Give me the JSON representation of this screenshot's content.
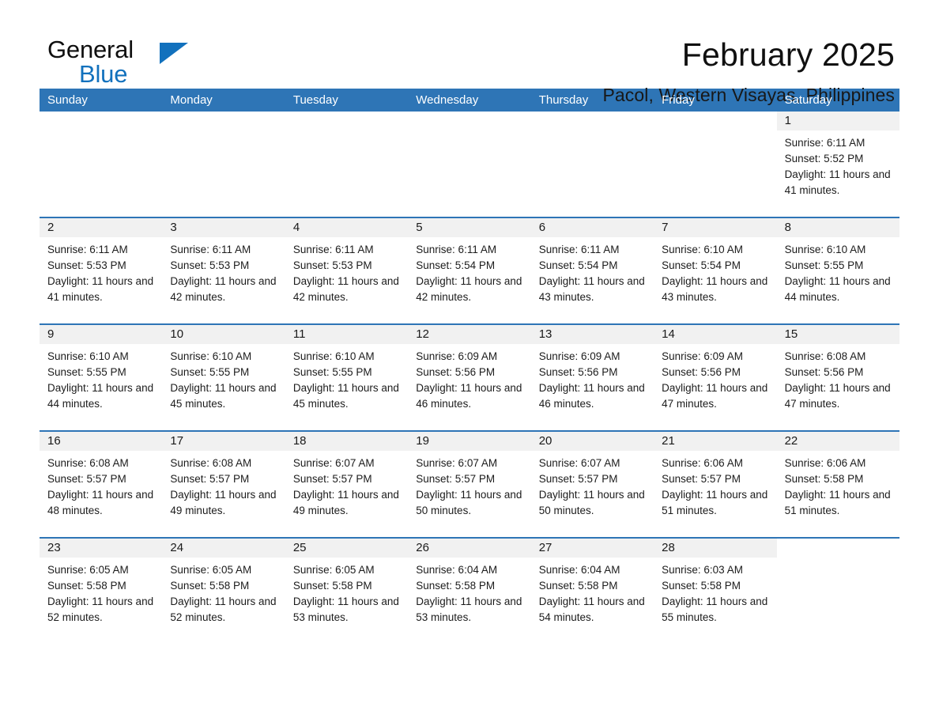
{
  "brand": {
    "name_part1": "General",
    "name_part2": "Blue",
    "triangle_color": "#1271bd"
  },
  "header": {
    "title": "February 2025",
    "subtitle": "Pacol, Western Visayas, Philippines"
  },
  "theme": {
    "header_blue": "#2e75b6",
    "date_strip_gray": "#f1f1f1",
    "text": "#1a1a1a"
  },
  "weekdays": [
    "Sunday",
    "Monday",
    "Tuesday",
    "Wednesday",
    "Thursday",
    "Friday",
    "Saturday"
  ],
  "weeks": [
    [
      {
        "date": "",
        "sunrise": "",
        "sunset": "",
        "daylight": "",
        "empty": true
      },
      {
        "date": "",
        "sunrise": "",
        "sunset": "",
        "daylight": "",
        "empty": true
      },
      {
        "date": "",
        "sunrise": "",
        "sunset": "",
        "daylight": "",
        "empty": true
      },
      {
        "date": "",
        "sunrise": "",
        "sunset": "",
        "daylight": "",
        "empty": true
      },
      {
        "date": "",
        "sunrise": "",
        "sunset": "",
        "daylight": "",
        "empty": true
      },
      {
        "date": "",
        "sunrise": "",
        "sunset": "",
        "daylight": "",
        "empty": true
      },
      {
        "date": "1",
        "sunrise": "Sunrise: 6:11 AM",
        "sunset": "Sunset: 5:52 PM",
        "daylight": "Daylight: 11 hours and 41 minutes.",
        "empty": false
      }
    ],
    [
      {
        "date": "2",
        "sunrise": "Sunrise: 6:11 AM",
        "sunset": "Sunset: 5:53 PM",
        "daylight": "Daylight: 11 hours and 41 minutes.",
        "empty": false
      },
      {
        "date": "3",
        "sunrise": "Sunrise: 6:11 AM",
        "sunset": "Sunset: 5:53 PM",
        "daylight": "Daylight: 11 hours and 42 minutes.",
        "empty": false
      },
      {
        "date": "4",
        "sunrise": "Sunrise: 6:11 AM",
        "sunset": "Sunset: 5:53 PM",
        "daylight": "Daylight: 11 hours and 42 minutes.",
        "empty": false
      },
      {
        "date": "5",
        "sunrise": "Sunrise: 6:11 AM",
        "sunset": "Sunset: 5:54 PM",
        "daylight": "Daylight: 11 hours and 42 minutes.",
        "empty": false
      },
      {
        "date": "6",
        "sunrise": "Sunrise: 6:11 AM",
        "sunset": "Sunset: 5:54 PM",
        "daylight": "Daylight: 11 hours and 43 minutes.",
        "empty": false
      },
      {
        "date": "7",
        "sunrise": "Sunrise: 6:10 AM",
        "sunset": "Sunset: 5:54 PM",
        "daylight": "Daylight: 11 hours and 43 minutes.",
        "empty": false
      },
      {
        "date": "8",
        "sunrise": "Sunrise: 6:10 AM",
        "sunset": "Sunset: 5:55 PM",
        "daylight": "Daylight: 11 hours and 44 minutes.",
        "empty": false
      }
    ],
    [
      {
        "date": "9",
        "sunrise": "Sunrise: 6:10 AM",
        "sunset": "Sunset: 5:55 PM",
        "daylight": "Daylight: 11 hours and 44 minutes.",
        "empty": false
      },
      {
        "date": "10",
        "sunrise": "Sunrise: 6:10 AM",
        "sunset": "Sunset: 5:55 PM",
        "daylight": "Daylight: 11 hours and 45 minutes.",
        "empty": false
      },
      {
        "date": "11",
        "sunrise": "Sunrise: 6:10 AM",
        "sunset": "Sunset: 5:55 PM",
        "daylight": "Daylight: 11 hours and 45 minutes.",
        "empty": false
      },
      {
        "date": "12",
        "sunrise": "Sunrise: 6:09 AM",
        "sunset": "Sunset: 5:56 PM",
        "daylight": "Daylight: 11 hours and 46 minutes.",
        "empty": false
      },
      {
        "date": "13",
        "sunrise": "Sunrise: 6:09 AM",
        "sunset": "Sunset: 5:56 PM",
        "daylight": "Daylight: 11 hours and 46 minutes.",
        "empty": false
      },
      {
        "date": "14",
        "sunrise": "Sunrise: 6:09 AM",
        "sunset": "Sunset: 5:56 PM",
        "daylight": "Daylight: 11 hours and 47 minutes.",
        "empty": false
      },
      {
        "date": "15",
        "sunrise": "Sunrise: 6:08 AM",
        "sunset": "Sunset: 5:56 PM",
        "daylight": "Daylight: 11 hours and 47 minutes.",
        "empty": false
      }
    ],
    [
      {
        "date": "16",
        "sunrise": "Sunrise: 6:08 AM",
        "sunset": "Sunset: 5:57 PM",
        "daylight": "Daylight: 11 hours and 48 minutes.",
        "empty": false
      },
      {
        "date": "17",
        "sunrise": "Sunrise: 6:08 AM",
        "sunset": "Sunset: 5:57 PM",
        "daylight": "Daylight: 11 hours and 49 minutes.",
        "empty": false
      },
      {
        "date": "18",
        "sunrise": "Sunrise: 6:07 AM",
        "sunset": "Sunset: 5:57 PM",
        "daylight": "Daylight: 11 hours and 49 minutes.",
        "empty": false
      },
      {
        "date": "19",
        "sunrise": "Sunrise: 6:07 AM",
        "sunset": "Sunset: 5:57 PM",
        "daylight": "Daylight: 11 hours and 50 minutes.",
        "empty": false
      },
      {
        "date": "20",
        "sunrise": "Sunrise: 6:07 AM",
        "sunset": "Sunset: 5:57 PM",
        "daylight": "Daylight: 11 hours and 50 minutes.",
        "empty": false
      },
      {
        "date": "21",
        "sunrise": "Sunrise: 6:06 AM",
        "sunset": "Sunset: 5:57 PM",
        "daylight": "Daylight: 11 hours and 51 minutes.",
        "empty": false
      },
      {
        "date": "22",
        "sunrise": "Sunrise: 6:06 AM",
        "sunset": "Sunset: 5:58 PM",
        "daylight": "Daylight: 11 hours and 51 minutes.",
        "empty": false
      }
    ],
    [
      {
        "date": "23",
        "sunrise": "Sunrise: 6:05 AM",
        "sunset": "Sunset: 5:58 PM",
        "daylight": "Daylight: 11 hours and 52 minutes.",
        "empty": false
      },
      {
        "date": "24",
        "sunrise": "Sunrise: 6:05 AM",
        "sunset": "Sunset: 5:58 PM",
        "daylight": "Daylight: 11 hours and 52 minutes.",
        "empty": false
      },
      {
        "date": "25",
        "sunrise": "Sunrise: 6:05 AM",
        "sunset": "Sunset: 5:58 PM",
        "daylight": "Daylight: 11 hours and 53 minutes.",
        "empty": false
      },
      {
        "date": "26",
        "sunrise": "Sunrise: 6:04 AM",
        "sunset": "Sunset: 5:58 PM",
        "daylight": "Daylight: 11 hours and 53 minutes.",
        "empty": false
      },
      {
        "date": "27",
        "sunrise": "Sunrise: 6:04 AM",
        "sunset": "Sunset: 5:58 PM",
        "daylight": "Daylight: 11 hours and 54 minutes.",
        "empty": false
      },
      {
        "date": "28",
        "sunrise": "Sunrise: 6:03 AM",
        "sunset": "Sunset: 5:58 PM",
        "daylight": "Daylight: 11 hours and 55 minutes.",
        "empty": false
      },
      {
        "date": "",
        "sunrise": "",
        "sunset": "",
        "daylight": "",
        "empty": true
      }
    ]
  ]
}
